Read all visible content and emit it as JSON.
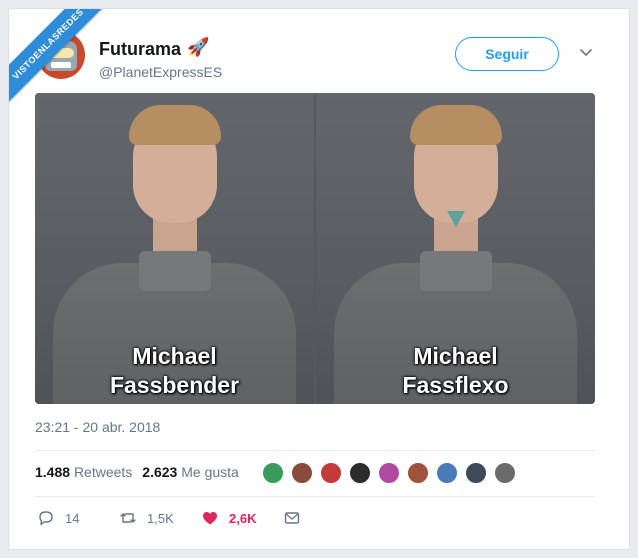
{
  "watermark": {
    "text": "VISTOENLASREDES"
  },
  "tweet": {
    "author_name": "Futurama",
    "author_emoji": "🚀",
    "handle": "@PlanetExpressES",
    "follow_label": "Seguir",
    "timestamp": "23:21 - 20 abr. 2018"
  },
  "media": {
    "left_caption_line1": "Michael",
    "left_caption_line2": "Fassbender",
    "right_caption_line1": "Michael",
    "right_caption_line2": "Fassflexo"
  },
  "stats": {
    "retweets_count": "1.488",
    "retweets_label": "Retweets",
    "likes_count": "2.623",
    "likes_label": "Me gusta"
  },
  "likers": [
    {
      "color": "#3a9b5a"
    },
    {
      "color": "#8a4a3c"
    },
    {
      "color": "#c23b3b"
    },
    {
      "color": "#2c2c2c"
    },
    {
      "color": "#b04aa0"
    },
    {
      "color": "#a0523a"
    },
    {
      "color": "#4a7ab8"
    },
    {
      "color": "#3c4a5a"
    },
    {
      "color": "#6b6b6b"
    }
  ],
  "actions": {
    "reply_count": "14",
    "retweet_count": "1,5K",
    "like_count": "2,6K"
  },
  "colors": {
    "accent": "#1da0f2",
    "like": "#e0245e",
    "muted": "#657786"
  }
}
